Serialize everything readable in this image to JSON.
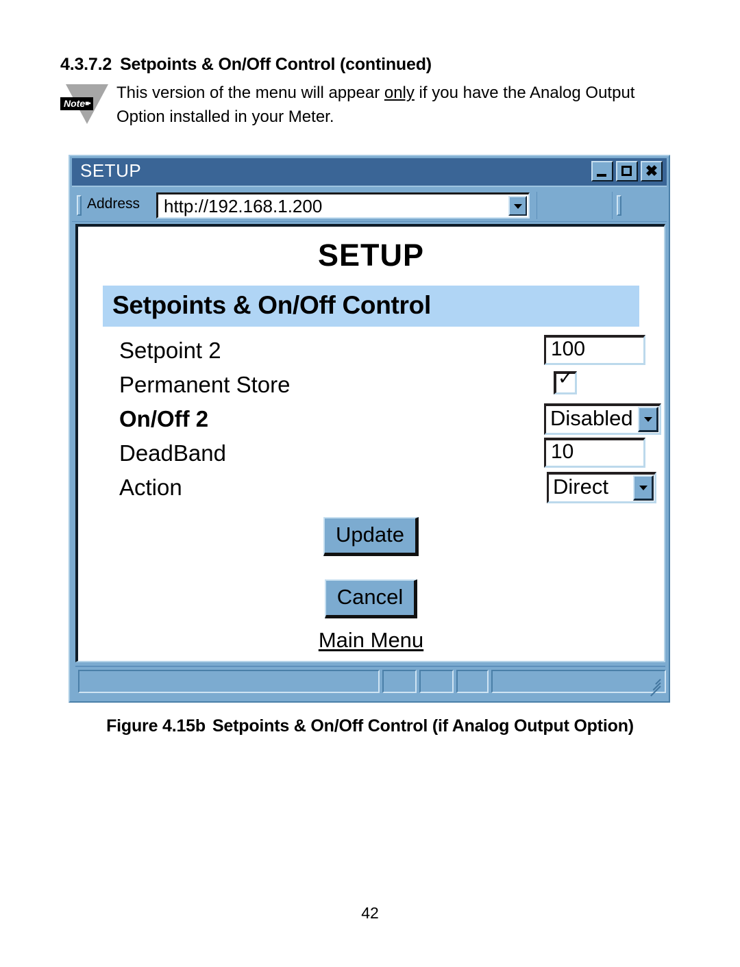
{
  "document": {
    "section_number": "4.3.7.2",
    "section_title": "Setpoints & On/Off Control (continued)",
    "note": {
      "badge_label": "Note",
      "text_part_1": "This version of the menu will appear ",
      "text_emphasis": "only",
      "text_part_2": " if you have the Analog Output Option installed in your Meter."
    },
    "figure_caption": {
      "number": "Figure 4.15b",
      "text": "Setpoints & On/Off Control (if Analog Output Option)"
    },
    "page_number": "42"
  },
  "browser": {
    "window_title": "SETUP",
    "controls": {
      "minimize": "minimize-icon",
      "maximize": "maximize-icon",
      "close": "close-icon"
    },
    "address_bar": {
      "label": "Address",
      "value": "http://192.168.1.200",
      "placeholder": "http://"
    }
  },
  "page": {
    "title": "SETUP",
    "banner": "Setpoints & On/Off Control",
    "fields": [
      {
        "label": "Setpoint 2",
        "type": "text",
        "value": "100",
        "bold": false
      },
      {
        "label": "Permanent Store",
        "type": "checkbox",
        "value": "checked",
        "bold": false
      },
      {
        "label": "On/Off 2",
        "type": "select",
        "value": "Disabled",
        "bold": true
      },
      {
        "label": "DeadBand",
        "type": "text",
        "value": "10",
        "bold": false
      },
      {
        "label": "Action",
        "type": "select",
        "value": "Direct",
        "bold": false
      }
    ],
    "buttons": {
      "update": "Update",
      "cancel": "Cancel"
    },
    "link": "Main Menu"
  },
  "colors": {
    "titlebar": "#3a6596",
    "toolbar": "#7cabd0",
    "banner": "#b0d5f5",
    "button_face": "#7cabd0",
    "note_triangle": "#a6a6a6"
  }
}
